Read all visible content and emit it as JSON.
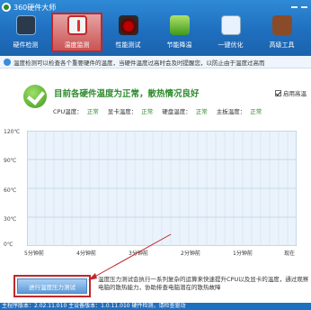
{
  "app": {
    "title": "360硬件大师"
  },
  "toolbar": {
    "items": [
      {
        "label": "硬件检测",
        "icon": "chip-icon",
        "active": false
      },
      {
        "label": "温度监测",
        "icon": "thermometer-icon",
        "active": true
      },
      {
        "label": "性能测试",
        "icon": "gauge-icon",
        "active": false
      },
      {
        "label": "节能降温",
        "icon": "leaf-icon",
        "active": false
      },
      {
        "label": "一键优化",
        "icon": "optimize-icon",
        "active": false
      },
      {
        "label": "高级工具",
        "icon": "toolbox-icon",
        "active": false
      }
    ]
  },
  "notice": {
    "text": "温度检测可以检查各个重要硬件的温度，当硬件温度过高时会及时提醒您，以防止由于温度过高而"
  },
  "status": {
    "title": "目前各硬件温度为正常，散热情况良好",
    "items": [
      {
        "label": "CPU温度：",
        "value": "正常"
      },
      {
        "label": "显卡温度：",
        "value": "正常"
      },
      {
        "label": "硬盘温度：",
        "value": "正常"
      },
      {
        "label": "主板温度：",
        "value": "正常"
      }
    ],
    "auto_open_label": "启用高温"
  },
  "chart_data": {
    "type": "line",
    "title": "",
    "xlabel": "",
    "ylabel": "",
    "y_ticks": [
      "120℃",
      "90℃",
      "60℃",
      "30℃",
      "0℃"
    ],
    "ylim": [
      0,
      120
    ],
    "x_ticks": [
      "5分钟前",
      "4分钟前",
      "3分钟前",
      "2分钟前",
      "1分钟前",
      "现在"
    ],
    "grid": true,
    "series": []
  },
  "stress": {
    "button_label": "进行温度压力测试",
    "description": "温度压力测试会执行一系列复杂的运算来快速提升CPU以及显卡的温度，通过观察电脑的散热能力，协助排查电脑潜在的散热故障"
  },
  "statusbar": {
    "text": "主程序版本：2.02.11.010    主设备版本：1.0.11.010    硬件检测，请检查驱动"
  }
}
